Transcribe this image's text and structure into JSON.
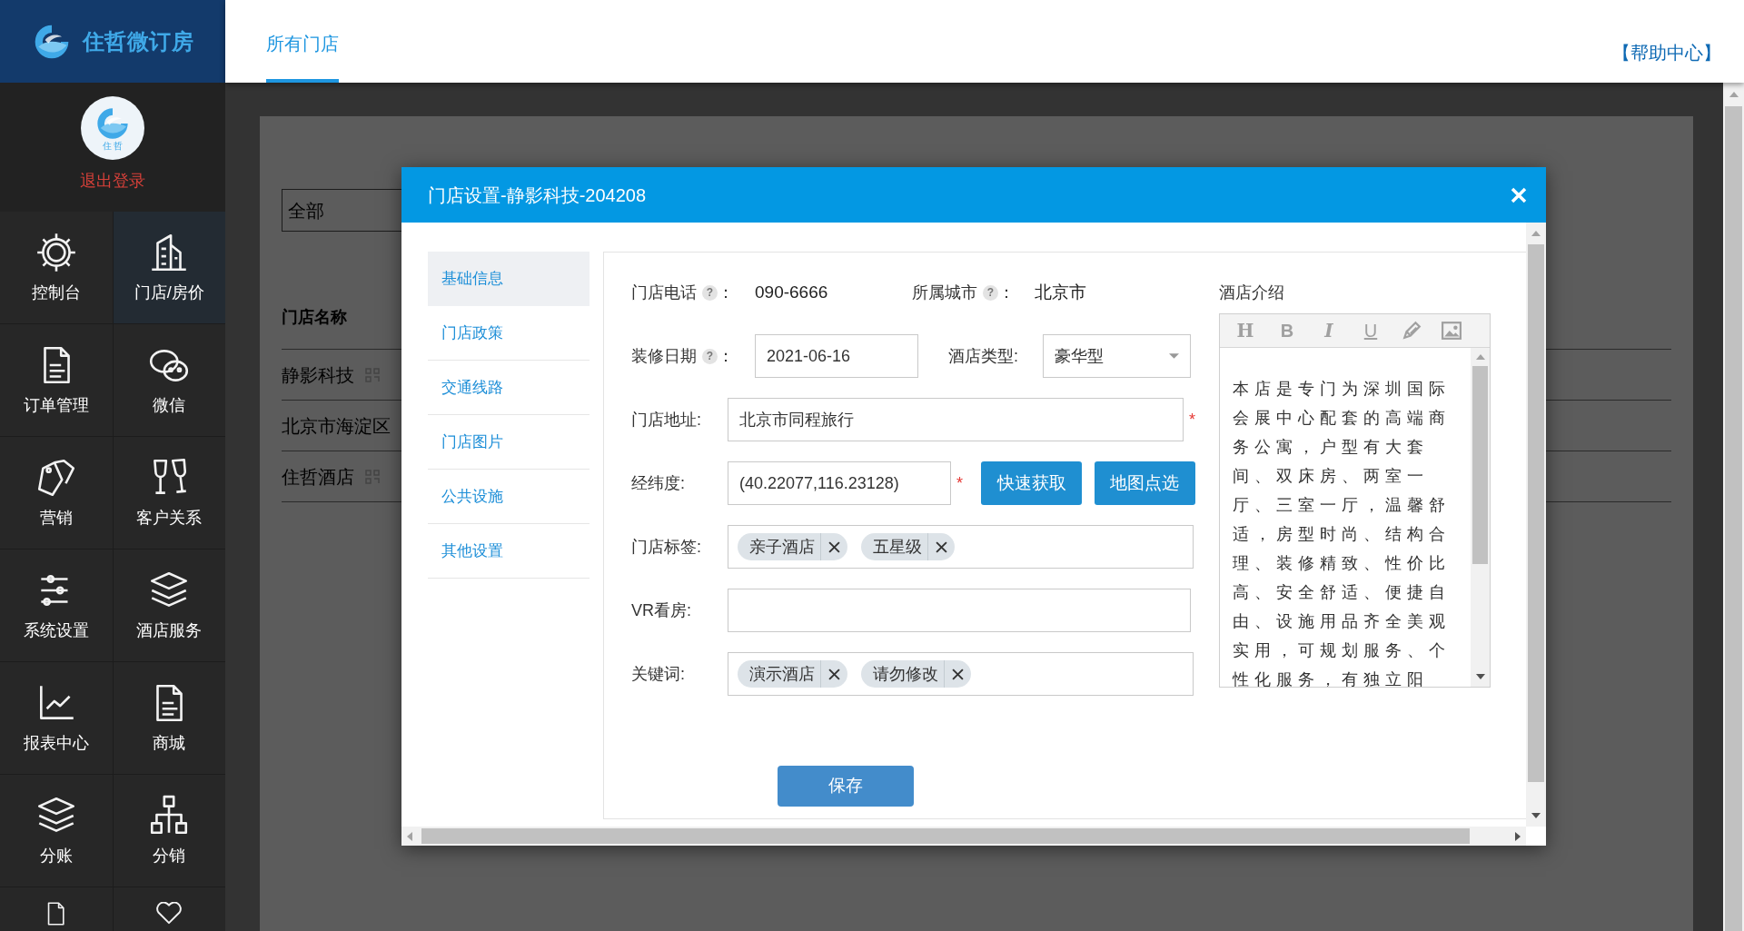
{
  "brand": {
    "name": "住哲微订房"
  },
  "account": {
    "avatar_text": "住 哲",
    "logout": "退出登录"
  },
  "sidebar": {
    "items": [
      {
        "label": "控制台",
        "selected": false
      },
      {
        "label": "门店/房价",
        "selected": true
      },
      {
        "label": "订单管理",
        "selected": false
      },
      {
        "label": "微信",
        "selected": false
      },
      {
        "label": "营销",
        "selected": false
      },
      {
        "label": "客户关系",
        "selected": false
      },
      {
        "label": "系统设置",
        "selected": false
      },
      {
        "label": "酒店服务",
        "selected": false
      },
      {
        "label": "报表中心",
        "selected": false
      },
      {
        "label": "商城",
        "selected": false
      },
      {
        "label": "分账",
        "selected": false
      },
      {
        "label": "分销",
        "selected": false
      },
      {
        "selected": false
      },
      {
        "selected": false
      }
    ]
  },
  "tabs": [
    {
      "label": "所有门店",
      "selected": true
    }
  ],
  "help_link": "【帮助中心】",
  "background_page": {
    "filter": "全部",
    "columns": [
      "门店名称"
    ],
    "rows": [
      {
        "name": "静影科技",
        "qr_code": true
      },
      {
        "name": "北京市海淀区",
        "qr_code": false
      },
      {
        "name": "住哲酒店",
        "qr_code": true
      }
    ]
  },
  "dialog": {
    "title": "门店设置-静影科技-204208",
    "nav": [
      {
        "label": "基础信息",
        "selected": true
      },
      {
        "label": "门店政策",
        "selected": false
      },
      {
        "label": "交通线路",
        "selected": false
      },
      {
        "label": "门店图片",
        "selected": false
      },
      {
        "label": "公共设施",
        "selected": false
      },
      {
        "label": "其他设置",
        "selected": false
      }
    ],
    "form": {
      "phone": {
        "label": "门店电话",
        "help": "?",
        "separator": "：",
        "value": "090-6666"
      },
      "city": {
        "label": "所属城市",
        "help": "?",
        "separator": "：",
        "value": "北京市"
      },
      "renovation_date": {
        "label": "装修日期",
        "help": "?",
        "separator": "：",
        "value": "2021-06-16"
      },
      "hotel_type": {
        "label": "酒店类型:",
        "value": "豪华型"
      },
      "address": {
        "label": "门店地址:",
        "value": "北京市同程旅行",
        "required_mark": "*"
      },
      "coordinates": {
        "label": "经纬度:",
        "value": "(40.22077,116.23128)",
        "required_mark": "*"
      },
      "coordinate_buttons": [
        "快速获取",
        "地图点选"
      ],
      "store_tags": {
        "label": "门店标签:",
        "tags": [
          "亲子酒店",
          "五星级"
        ]
      },
      "vr": {
        "label": "VR看房:"
      },
      "keywords": {
        "label": "关键词:",
        "tags": [
          "演示酒店",
          "请勿修改"
        ]
      },
      "intro": {
        "label": "酒店介绍",
        "toolbar": [
          {
            "kind": "heading",
            "label": "H"
          },
          {
            "kind": "bold",
            "label": "B"
          },
          {
            "kind": "italic",
            "label": "I"
          },
          {
            "kind": "underline",
            "label": "U"
          },
          {
            "kind": "pen"
          },
          {
            "kind": "image"
          }
        ],
        "text": "本店是专门为深圳国际会展中心配套的高端商务公寓，户型有大套间、双床房、两室一厅、三室一厅，温馨舒适，房型时尚、结构合理、装修精致、性价比高、安全舒适、便捷自由、设施用品齐全美观实用，可规划服务、个性化服务，有独立阳"
      }
    },
    "save": "保存"
  }
}
